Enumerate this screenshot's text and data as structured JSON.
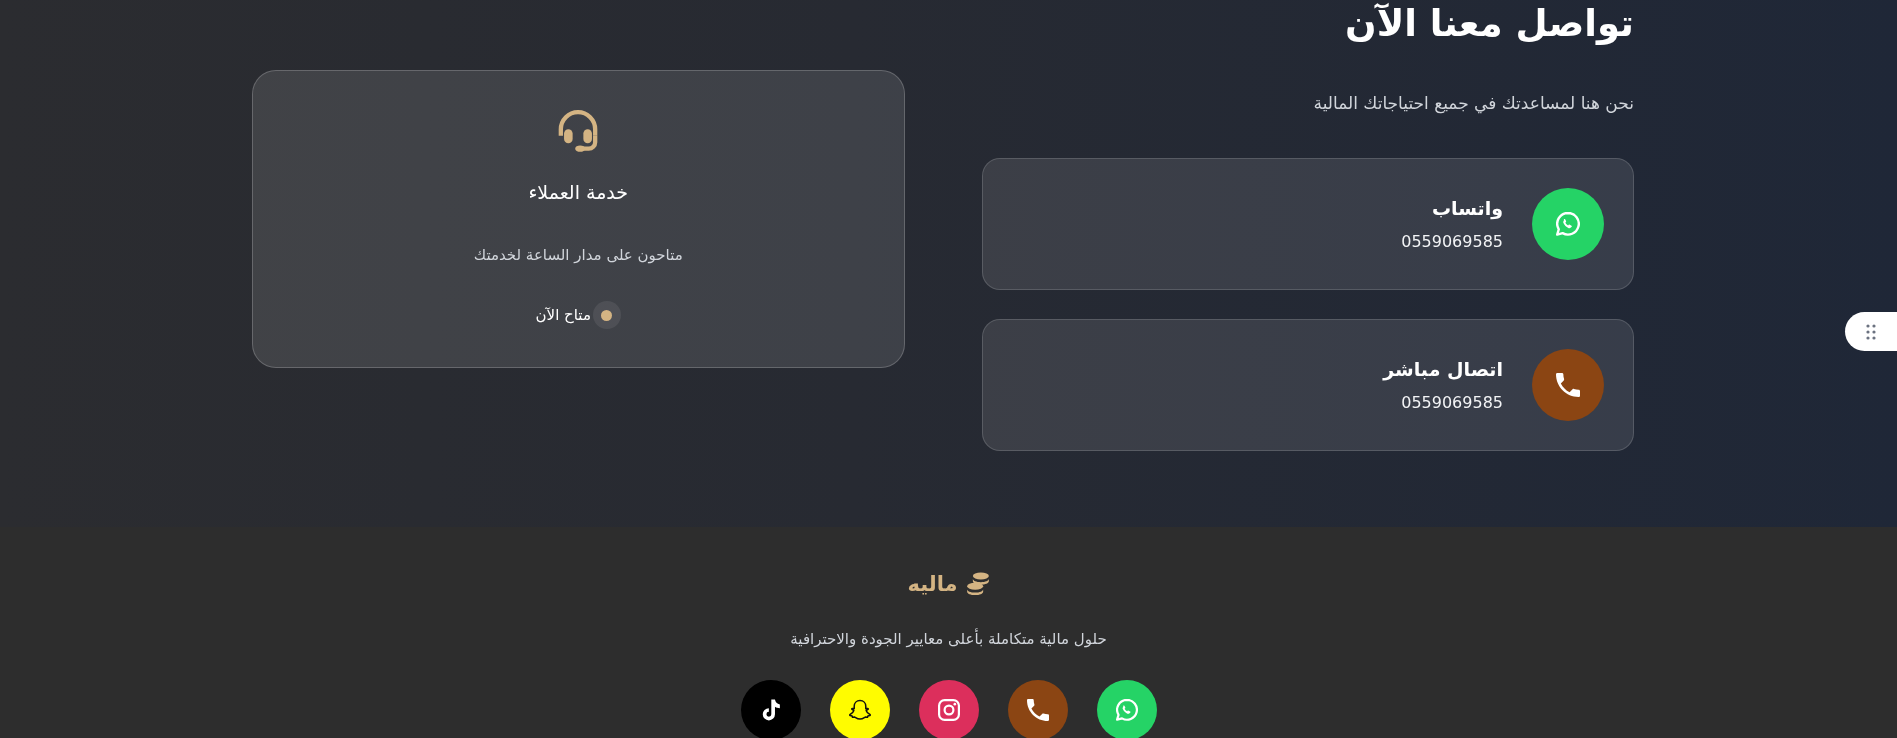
{
  "header": {
    "title": "تواصل معنا الآن",
    "subtitle": "نحن هنا لمساعدتك في جميع احتياجاتك المالية"
  },
  "contact_methods": [
    {
      "kind": "whatsapp",
      "title": "واتساب",
      "value": "0559069585",
      "color": "#25d366"
    },
    {
      "kind": "phone",
      "title": "اتصال مباشر",
      "value": "0559069585",
      "color": "#8b4513"
    }
  ],
  "support_card": {
    "title": "خدمة العملاء",
    "description": "متاحون على مدار الساعة لخدمتك",
    "status": {
      "label": "متاح الآن",
      "online": true
    }
  },
  "footer": {
    "brand": "ماليه",
    "tagline": "حلول مالية متكاملة بأعلى معايير الجودة والاحترافية",
    "social_links": [
      {
        "kind": "whatsapp",
        "color": "#25d366"
      },
      {
        "kind": "phone",
        "color": "#8b4513"
      },
      {
        "kind": "instagram",
        "color": "#dc2f5c"
      },
      {
        "kind": "snapchat",
        "color": "#fffc00"
      },
      {
        "kind": "tiktok",
        "color": "#000000"
      }
    ]
  }
}
